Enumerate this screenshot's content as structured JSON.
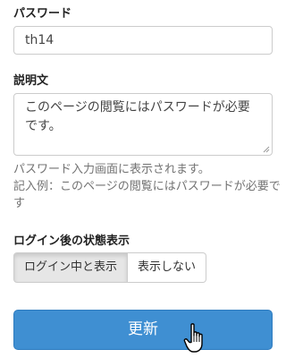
{
  "password": {
    "label": "パスワード",
    "value": "th14"
  },
  "description": {
    "label": "説明文",
    "value": "このページの閲覧にはパスワードが必要です。",
    "help_line1": "パスワード入力画面に表示されます。",
    "help_line2": "記入例：このページの閲覧にはパスワードが必要です"
  },
  "login_state": {
    "label": "ログイン後の状態表示",
    "options": [
      "ログイン中と表示",
      "表示しない"
    ],
    "selected": "ログイン中と表示"
  },
  "submit": {
    "label": "更新"
  },
  "icons": {
    "cursor": "hand-pointer-icon",
    "resize": "resize-grip-icon"
  },
  "colors": {
    "primary": "#3f8fd2",
    "active_segment": "#e6e6e6"
  }
}
